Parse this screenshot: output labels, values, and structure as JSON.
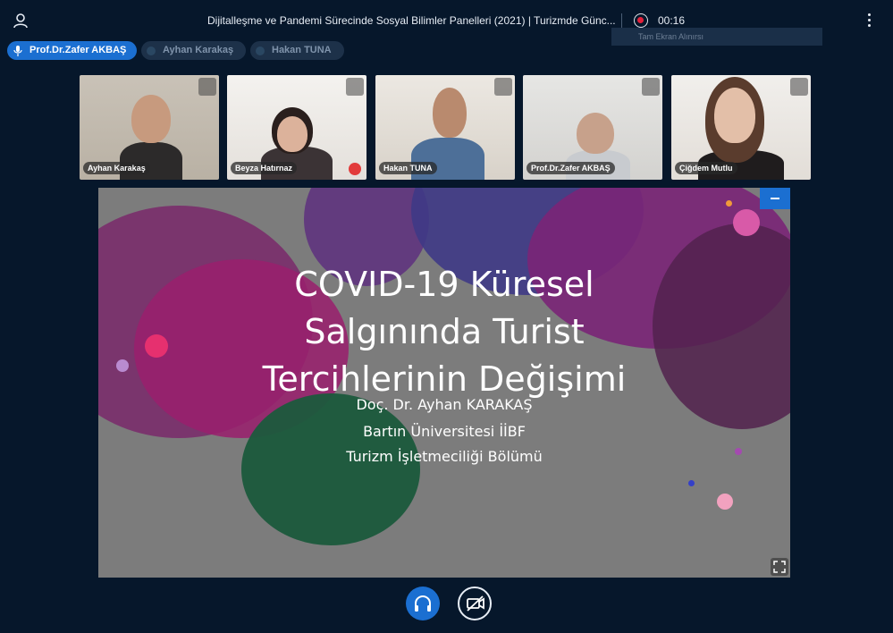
{
  "header": {
    "meeting_title": "Dijitalleşme ve Pandemi Sürecinde Sosyal Bilimler Panelleri (2021) | Turizmde Günc...",
    "recording_time": "00:16",
    "recording_tooltip": "Tam Ekran Alınırsı"
  },
  "talkers": [
    {
      "label": "Prof.Dr.Zafer AKBAŞ",
      "state": "speaking"
    },
    {
      "label": "Ayhan Karakaş",
      "state": "idle"
    },
    {
      "label": "Hakan TUNA",
      "state": "idle"
    }
  ],
  "participants": [
    {
      "name": "Ayhan Karakaş"
    },
    {
      "name": "Beyza Hatırnaz"
    },
    {
      "name": "Hakan TUNA"
    },
    {
      "name": "Prof.Dr.Zafer AKBAŞ"
    },
    {
      "name": "Çiğdem Mutlu"
    }
  ],
  "slide": {
    "title_line1": "COVID-19 Küresel",
    "title_line2": "Salgınında Turist",
    "title_line3": "Tercihlerinin Değişimi",
    "author": "Doç. Dr. Ayhan KARAKAŞ",
    "institution": "Bartın Üniversitesi İİBF",
    "department": "Turizm İşletmeciliği Bölümü"
  },
  "colors": {
    "background": "#06172b",
    "accent": "#1b6fd1",
    "recording": "#e3213b"
  },
  "icons": {
    "user": "user-icon",
    "menu": "kebab-menu-icon",
    "audio": "headphones-icon",
    "video": "camera-off-icon",
    "expand": "fullscreen-icon"
  }
}
